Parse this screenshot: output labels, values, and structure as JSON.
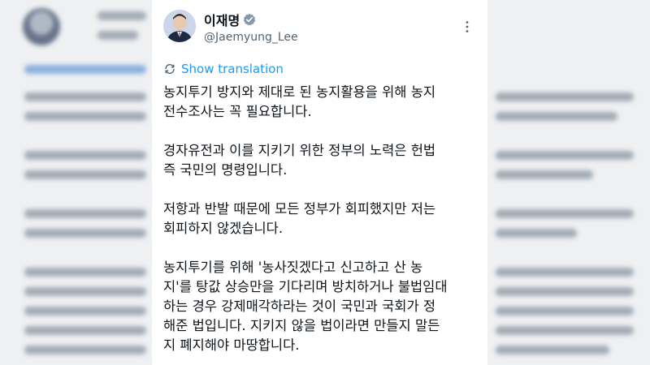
{
  "tweet": {
    "display_name": "이재명",
    "handle": "@Jaemyung_Lee",
    "translate_label": "Show translation",
    "paragraphs": [
      "농지투기 방지와 제대로 된 농지활용을 위해 농지\n전수조사는 꼭 필요합니다.",
      "경자유전과 이를 지키기 위한 정부의 노력은 헌법\n즉 국민의 명령입니다.",
      "저항과 반발 때문에 모든 정부가 회피했지만 저는\n회피하지 않겠습니다.",
      "농지투기를 위해 '농사짓겠다고 신고하고 산 농\n지'를 탕값 상승만을 기다리며 방치하거나 불법임대\n하는 경우 강제매각하라는 것이 국민과 국회가 정\n해준 법입니다. 지키지 않을 법이라면 만들지 말든\n지 폐지해야 마땅합니다."
    ]
  },
  "icons": {
    "verified": "verified-badge-icon",
    "more": "more-options-icon",
    "translate": "translate-icon",
    "avatar": "profile-avatar"
  },
  "colors": {
    "link": "#1d9bf0",
    "text": "#0f1419",
    "secondary": "#536471"
  }
}
